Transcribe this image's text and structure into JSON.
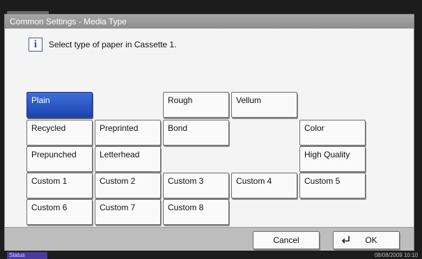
{
  "window": {
    "title": "Common Settings - Media Type"
  },
  "message": "Select type of paper in Cassette 1.",
  "media_buttons": {
    "plain": "Plain",
    "rough": "Rough",
    "vellum": "Vellum",
    "recycled": "Recycled",
    "preprinted": "Preprinted",
    "bond": "Bond",
    "color": "Color",
    "prepunched": "Prepunched",
    "letterhead": "Letterhead",
    "high_quality": "High Quality",
    "custom1": "Custom 1",
    "custom2": "Custom 2",
    "custom3": "Custom 3",
    "custom4": "Custom 4",
    "custom5": "Custom 5",
    "custom6": "Custom 6",
    "custom7": "Custom 7",
    "custom8": "Custom 8"
  },
  "selected": "Plain",
  "footer": {
    "cancel": "Cancel",
    "ok": "OK"
  },
  "status": {
    "label": "Status",
    "datetime": "08/08/2009   10:10"
  },
  "colors": {
    "selected_blue": "#2a56c6",
    "title_bar": "#9a9a9a",
    "status_tab": "#4a3aa0"
  }
}
